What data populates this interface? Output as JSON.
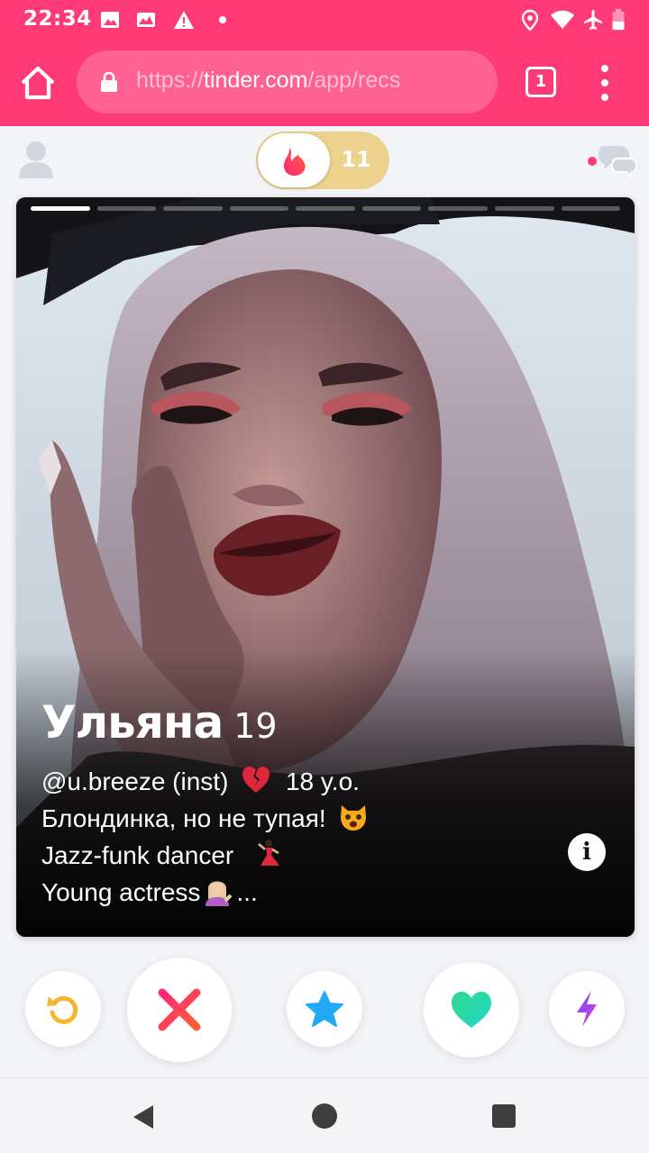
{
  "status_bar": {
    "time": "22:34",
    "left_icons": [
      "image-icon",
      "photo-icon",
      "warning-icon",
      "dot-icon"
    ],
    "right_icons": [
      "location-icon",
      "wifi-icon",
      "airplane-mode-icon",
      "battery-icon"
    ]
  },
  "browser": {
    "url_scheme": "https://",
    "url_host": "tinder.com",
    "url_path": "/app/recs",
    "tab_count": "1",
    "icons": [
      "home-icon",
      "lock-icon",
      "tabs-icon",
      "more-vert-icon"
    ]
  },
  "header": {
    "likes_count": "11",
    "icons": [
      "profile-icon",
      "flame-icon",
      "messages-icon"
    ],
    "brand_color": "#fe3a77",
    "gold_color": "#ecd28c"
  },
  "card": {
    "photo_count": 9,
    "active_photo": 1,
    "name": "Ульяна",
    "age": "19",
    "bio": {
      "line1_text": "@u.breeze (inst)",
      "line1_emoji": "broken-heart",
      "line1_tail": "18 y.o.",
      "line2_text": "Блондинка, но не тупая!",
      "line2_emoji": "weary-cat",
      "line3_text": "Jazz-funk dancer",
      "line3_emoji": "dancer",
      "line4_text": "Young actress",
      "line4_emoji": "tipping-hand-person",
      "line4_tail": "..."
    },
    "info_label": "i"
  },
  "actions": [
    {
      "name": "rewind",
      "icon": "rewind-icon",
      "color": "#f5b730"
    },
    {
      "name": "nope",
      "icon": "close-icon",
      "color": "#fd4a5f"
    },
    {
      "name": "super-like",
      "icon": "star-icon",
      "color": "#1fa9f7"
    },
    {
      "name": "like",
      "icon": "heart-icon",
      "color": "#2ce3a8"
    },
    {
      "name": "boost",
      "icon": "bolt-icon",
      "color": "#a54bf0"
    }
  ],
  "nav": [
    "back-icon",
    "home-icon",
    "recents-icon"
  ]
}
